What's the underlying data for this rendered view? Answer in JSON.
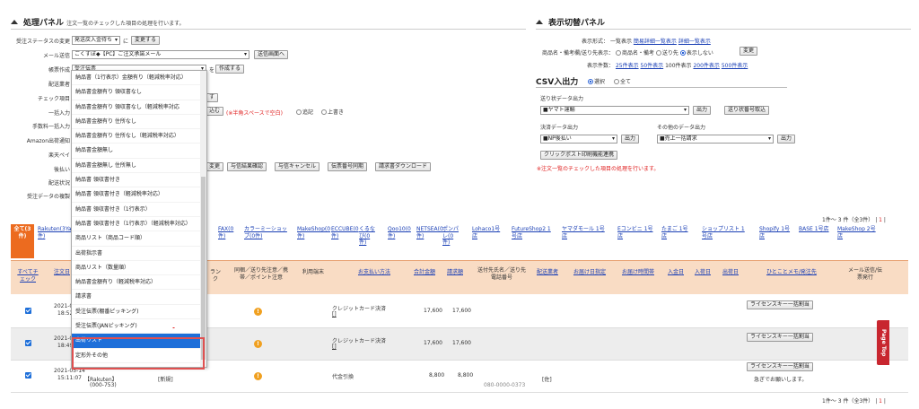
{
  "left_panel": {
    "title": "処理パネル",
    "subtitle": "注文一覧のチェックした項目の処理を行います。",
    "status_change": {
      "label": "受注ステータスの変更",
      "select": "発送戻入金待ち",
      "connector": "に",
      "button": "変更する"
    },
    "mail": {
      "label": "メール送信",
      "select": "ごくすぼ◆【PC】ご注文承諾メール",
      "button": "送信画面へ"
    },
    "form": {
      "label": "帳票作成",
      "select": "受注伝票",
      "connector": "を",
      "button": "作成する"
    },
    "truncated_labels": [
      "配送業者",
      "チェック項目",
      "一括入力",
      "手数料一括入力",
      "Amazon出荷通知",
      "楽天ペイ",
      "後払い",
      "配送状況",
      "受注データの複製"
    ],
    "bulk_note": "(※半角スペースで空白)",
    "bulk_radio_add": "追記",
    "bulk_radio_overwrite": "上書き",
    "bulk_button_tail": "込む",
    "check_button_tail": "す",
    "buttons_row": [
      "変更",
      "与信結果確認",
      "与信キャンセル",
      "伝票番号同期",
      "請求書ダウンロード"
    ]
  },
  "dropdown": {
    "items": [
      "納品書（1行表示）金額有り（軽減税率対応）",
      "納品書金額有り 領収書なし",
      "納品書金額有り 領収書なし（軽減税率対応",
      "納品書金額有り 住所なし",
      "納品書金額有り 住所なし（軽減税率対応）",
      "納品書金額無し",
      "納品書金額無し 住所無し",
      "納品書 領収書付き",
      "納品書 領収書付き（軽減税率対応）",
      "納品書 領収書付き（1行表示）",
      "納品書 領収書付き（1行表示）（軽減税率対応）",
      "商品リスト（商品コード順）",
      "出荷指示書",
      "商品リスト（数量順）",
      "納品書金額有り（軽減税率対応）",
      "請求書",
      "受注伝票(棚番ピッキング)",
      "受注伝票(JANピッキング)",
      "出荷リスト",
      "定形外その他"
    ],
    "highlighted": "出荷リスト"
  },
  "right_panel": {
    "title": "表示切替パネル",
    "display_format_label": "表示形式：",
    "display_format_options": [
      "一覧表示",
      "簡易詳細一覧表示",
      "詳細一覧表示"
    ],
    "product_label": "商品名・備考欄/送り先表示：",
    "product_radios": [
      "商品名・備考",
      "送り先",
      "表示しない"
    ],
    "product_button": "変更",
    "count_label": "表示件数：",
    "count_options": [
      "25件表示",
      "50件表示",
      "100件表示",
      "200件表示",
      "500件表示"
    ],
    "count_selected": "100件表示"
  },
  "csv_panel": {
    "title": "CSV入出力",
    "radios": [
      "選択",
      "全て"
    ],
    "shipping_label": "送り状データ出力",
    "shipping_select": "■ヤマト運輸",
    "shipping_buttons": [
      "出力",
      "送り状番号取込"
    ],
    "payment_label": "決済データ出力",
    "payment_select": "■NP後払い",
    "payment_button": "出力",
    "other_label": "その他のデータ出力",
    "other_select": "■売上一括請求",
    "other_button": "出力",
    "clickpost_button": "クリックポスト印刷機能連携",
    "note": "※注文一覧のチェックした項目の処理を行います。"
  },
  "result_count_top": "1件～ 3 件（全3件）",
  "result_count_bottom": "1件～ 3 件（全3件）",
  "page_num": "1",
  "mall_tabs": [
    {
      "label": "全て(3件)",
      "active": true
    },
    {
      "label": "Rakuten(3件)"
    },
    {
      "label": "Ya"
    },
    {
      "label": "FAX(0件)"
    },
    {
      "label": "カラーミーショップ(0件)"
    },
    {
      "label": "MakeShop(0件)"
    },
    {
      "label": "ECCUBE(0件)"
    },
    {
      "label": "くるなび(0件)"
    },
    {
      "label": "Qoo10(0件)"
    },
    {
      "label": "NETSEA(0件)"
    },
    {
      "label": "ポンパレ(0件)"
    },
    {
      "label": "Lohaco1号店"
    },
    {
      "label": "FutureShop2 1号店"
    },
    {
      "label": "ヤマダモール 1号店"
    },
    {
      "label": "Eコンビニ 1号店"
    },
    {
      "label": "たまご 1号店"
    },
    {
      "label": "ショップリスト 1号店"
    },
    {
      "label": "Shopify 1号店"
    },
    {
      "label": "BASE 1号店"
    },
    {
      "label": "MakeShop 2号店"
    }
  ],
  "table": {
    "headers": [
      "すべてチェック",
      "注文日",
      "ランク",
      "同梱／送り先注意／携帯／ポイント注意",
      "利用端末",
      "お支払い方法",
      "合計金額",
      "請求額",
      "送付先氏名／送り先電話番号",
      "配送業者",
      "お届け日指定",
      "お届け時間帯",
      "入金日",
      "入荷日",
      "出荷日",
      "ひとことメモ/発注先",
      "メール送信/伝票発行"
    ],
    "rows": [
      {
        "date": "2021-05",
        "time": "18:52",
        "payment": "クレジットカード決済",
        "total": "17,600",
        "billed": "17,600",
        "memo_button": "ライセンスキー一括割当",
        "bg": "#ffffff"
      },
      {
        "date": "2021-05",
        "time": "18:49",
        "payment": "クレジットカード決済",
        "total": "17,600",
        "billed": "17,600",
        "memo_button": "ライセンスキー一括割当",
        "bg": "#ededed"
      },
      {
        "date": "2021-05-14",
        "time": "15:11:07",
        "mall": "【Rakuten】",
        "order_id": "(000-753)",
        "rank": "[新規]",
        "payment": "代金引換",
        "total": "8,800",
        "billed": "8,800",
        "carrier": "[佐]",
        "phone": "080-0000-0373",
        "memo_button": "ライセンスキー一括割当",
        "memo_text": "急ぎでお願いします。",
        "bg": "#ffffff"
      }
    ]
  },
  "page_top": "Page Top",
  "colors": {
    "accent": "#ec6b1f",
    "link": "#1a3fb5",
    "highlight": "#1e6fd9",
    "pagetop": "#c8262f"
  }
}
